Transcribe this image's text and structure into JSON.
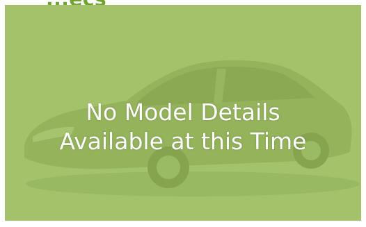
{
  "heading_clipped": "...ecs",
  "placeholder": {
    "line1": "No Model Details",
    "line2": "Available at this Time",
    "image_icon": "car-silhouette-icon",
    "background_color": "#a3c26a",
    "accent_color": "#6ea32d"
  }
}
